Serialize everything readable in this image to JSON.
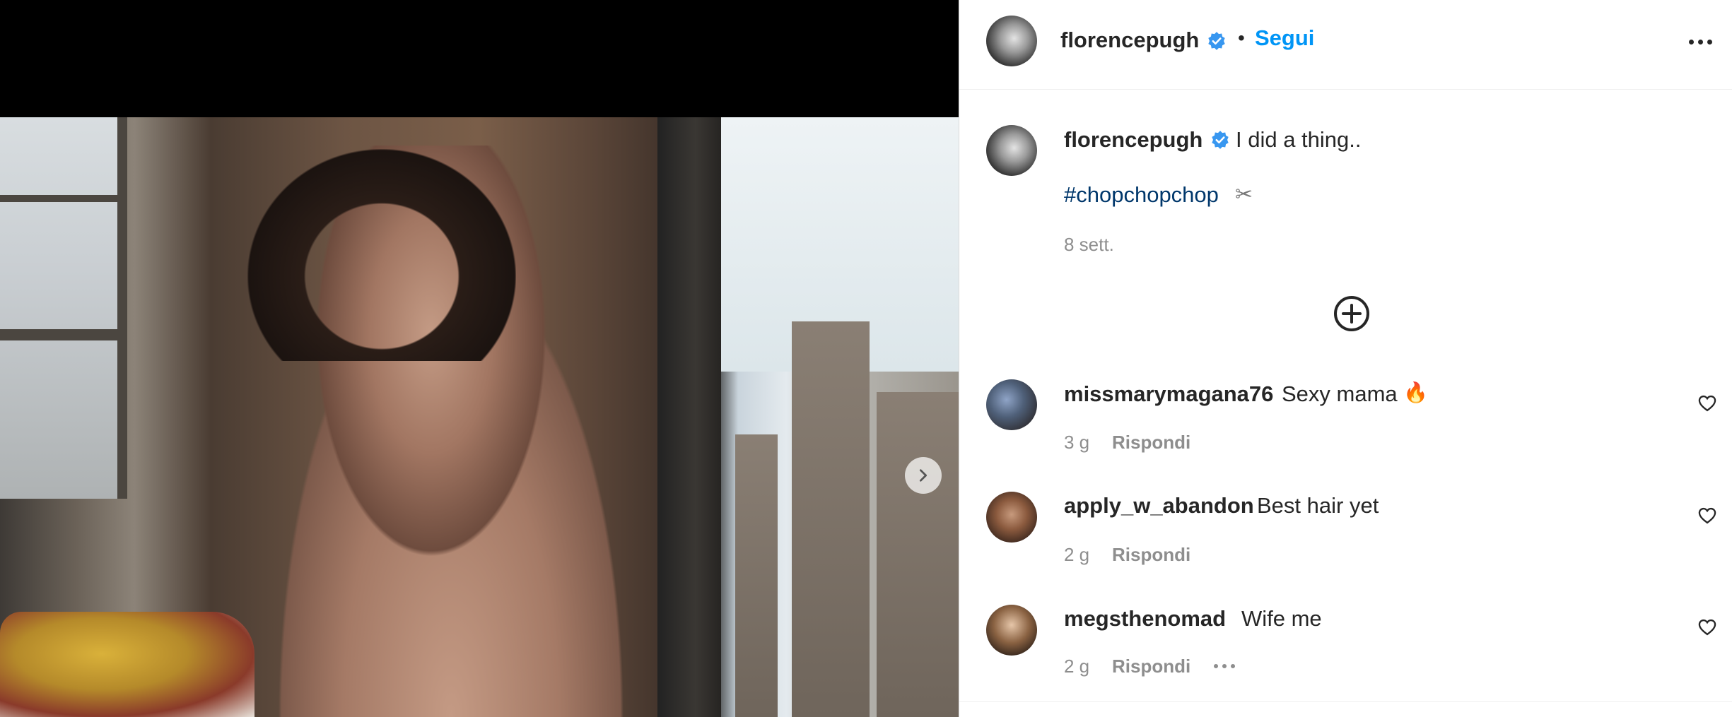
{
  "header": {
    "username": "florencepugh",
    "separator": "•",
    "follow_label": "Segui"
  },
  "caption": {
    "username": "florencepugh",
    "text": "I did a thing..",
    "hashtag": "#chopchopchop",
    "emoji": "✂",
    "timestamp": "8 sett."
  },
  "comments": [
    {
      "username": "missmarymagana76",
      "text": "Sexy mama",
      "emoji": "🔥",
      "age": "3 g",
      "reply_label": "Rispondi"
    },
    {
      "username": "apply_w_abandon",
      "text": "Best hair yet",
      "age": "2 g",
      "reply_label": "Rispondi"
    },
    {
      "username": "megsthenomad",
      "text": "Wife me",
      "age": "2 g",
      "reply_label": "Rispondi"
    }
  ],
  "icons": {
    "verified": "verified-badge-icon",
    "more": "more-options-icon",
    "load_more": "plus-circle-icon",
    "like": "heart-icon",
    "next": "chevron-right-icon"
  },
  "colors": {
    "link_blue": "#0095f6",
    "hashtag_blue": "#00376b",
    "verified_blue": "#3897f0",
    "muted": "#8e8e8e",
    "text": "#262626"
  }
}
